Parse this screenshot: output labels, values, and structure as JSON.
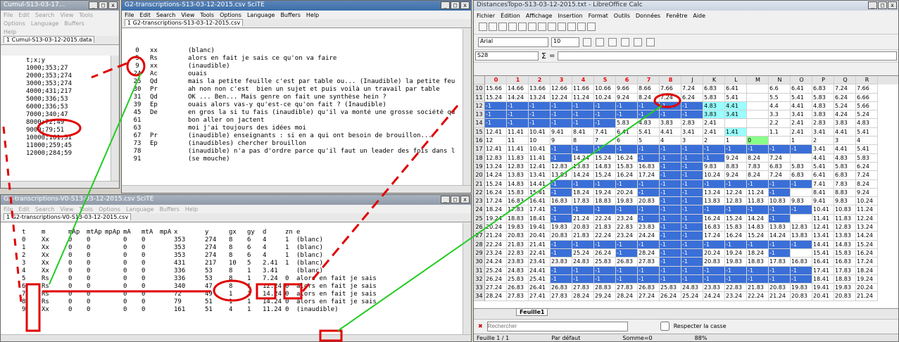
{
  "colors": {
    "annot_red": "#e00000",
    "annot_green": "#22cc22",
    "cell_blue": "#3a6fd8",
    "cell_cyan": "#99ffff",
    "cell_green": "#88ff88"
  },
  "w1": {
    "title": "Cumul-S13-03-17...",
    "menu": [
      "File",
      "Edit",
      "Search",
      "View",
      "Tools"
    ],
    "menu2": [
      "Options",
      "Language",
      "Buffers"
    ],
    "menu3": [
      "Help"
    ],
    "tab": "1 Cumul-S13-03-12-2015.data",
    "lines": [
      "t;x;y",
      "1000;353;27",
      "2000;353;274",
      "3000;353;274",
      "4000;431;217",
      "5000;336;53",
      "6000;336;53",
      "7000;340;47",
      "8000;72;49",
      "9000;79;51",
      "10000;161;51",
      "11000;259;45",
      "12000;284;59"
    ]
  },
  "w2": {
    "title": "G2-transcriptions-S13-03-12-2015.csv  SciTE",
    "menu": [
      "File",
      "Edit",
      "Search",
      "View",
      "Tools",
      "Options",
      "Language",
      "Buffers",
      "Help"
    ],
    "tab": "1 G2-transcriptions-S13-03-12-2015.csv",
    "rows": [
      {
        "n": "0",
        "s": "xx",
        "t": "(blanc)"
      },
      {
        "n": "5",
        "s": "Rs",
        "t": "alors en fait je sais ce qu'on va faire"
      },
      {
        "n": "9",
        "s": "xx",
        "t": "(inaudible)"
      },
      {
        "n": "24",
        "s": "Ac",
        "t": "ouais"
      },
      {
        "n": "25",
        "s": "Qd",
        "t": "mais la petite feuille c'est par table ou... (Inaudible) la petite feuille"
      },
      {
        "n": "30",
        "s": "Pr",
        "t": "ah non non c'est  bien un sujet et puis voilà un travail par table"
      },
      {
        "n": "31",
        "s": "Qd",
        "t": "OK ... Ben... Mais genre on fait une synthèse hein ?"
      },
      {
        "n": "39",
        "s": "Ep",
        "t": "ouais alors vas-y qu'est-ce qu'on fait ? (Inaudible)"
      },
      {
        "n": "45",
        "s": "De",
        "t": "en gros la si tu fais (inaudible) qu'il va monté une grosse société qu"
      },
      {
        "n": "61",
        "s": "",
        "t": "bon aller on jactent"
      },
      {
        "n": "63",
        "s": "",
        "t": "moi j'ai toujours des idées moi"
      },
      {
        "n": "67",
        "s": "Pr",
        "t": "(inaudible) enseignants : si en a qui ont besoin de brouillon..."
      },
      {
        "n": "73",
        "s": "Ep",
        "t": "(inaudibles) chercher brouillon"
      },
      {
        "n": "78",
        "s": "",
        "t": "(inaudible) n'a pas d'ordre parce qu'il faut un leader des fois dans la"
      },
      {
        "n": "91",
        "s": "",
        "t": "(se mouche)"
      }
    ]
  },
  "w3": {
    "title": "G2-transcriptions-V0-S13-03-12-2015.csv  SciTE",
    "menu": [
      "File",
      "Edit",
      "Search",
      "View",
      "Tools",
      "Options",
      "Language",
      "Buffers",
      "Help"
    ],
    "tab": "1 G2-transcriptions-V0-S13-03-12-2015.csv",
    "headers": [
      "t",
      "m",
      "mAp",
      "mtAp",
      "mpAp",
      "mA",
      "mtA",
      "mpA",
      "x",
      "y",
      "gx",
      "gy",
      "d",
      "zn",
      "e"
    ],
    "rows": [
      [
        "0",
        "Xx",
        "0",
        "0",
        "",
        "0",
        "0",
        "",
        "353",
        "274",
        "8",
        "6",
        "4",
        "1",
        "(blanc)"
      ],
      [
        "1",
        "Xx",
        "0",
        "0",
        "",
        "0",
        "0",
        "",
        "353",
        "274",
        "8",
        "6",
        "4",
        "1",
        "(blanc)"
      ],
      [
        "2",
        "Xx",
        "0",
        "0",
        "",
        "0",
        "0",
        "",
        "353",
        "274",
        "8",
        "6",
        "4",
        "1",
        "(blanc)"
      ],
      [
        "3",
        "Xx",
        "0",
        "0",
        "",
        "0",
        "0",
        "",
        "431",
        "217",
        "10",
        "5",
        "2.41",
        "1",
        "(blanc)"
      ],
      [
        "4",
        "Xx",
        "0",
        "0",
        "",
        "0",
        "0",
        "",
        "336",
        "53",
        "8",
        "1",
        "3.41",
        "",
        "(blanc)"
      ],
      [
        "5",
        "Rs",
        "0",
        "0",
        "",
        "0",
        "0",
        "",
        "336",
        "53",
        "8",
        "1",
        "7.24",
        "0",
        "alors en fait je sais ce qu"
      ],
      [
        "6",
        "Rs",
        "0",
        "0",
        "",
        "0",
        "0",
        "",
        "340",
        "47",
        "8",
        "1",
        "12.24",
        "0",
        "alors en fait je sais ce qu"
      ],
      [
        "7",
        "Rs",
        "0",
        "0",
        "",
        "0",
        "0",
        "",
        "72",
        "49",
        "1",
        "1",
        "14.24",
        "0",
        "alors en fait je sais ce qu"
      ],
      [
        "8",
        "Rs",
        "0",
        "0",
        "",
        "0",
        "0",
        "",
        "79",
        "51",
        "1",
        "1",
        "14.24",
        "0",
        "alors en fait je sais ce qu"
      ],
      [
        "9",
        "Xx",
        "0",
        "0",
        "",
        "0",
        "0",
        "",
        "161",
        "51",
        "4",
        "1",
        "11.24",
        "0",
        "(inaudible)"
      ]
    ]
  },
  "w4": {
    "title": "DistancesTopo-S13-03-12-2015.txt - LibreOffice Calc",
    "menu": [
      "Fichier",
      "Édition",
      "Affichage",
      "Insertion",
      "Format",
      "Outils",
      "Données",
      "Fenêtre",
      "Aide"
    ],
    "font": "Arial",
    "size": "10",
    "cellref": "S28",
    "sheet": "Feuille1",
    "search_placeholder": "Rechercher",
    "match_case": "Respecter la casse",
    "status": [
      "Feuille 1 / 1",
      "Par défaut",
      "Somme=0",
      "88%"
    ],
    "cols": [
      "A",
      "B",
      "C",
      "D",
      "E",
      "F",
      "G",
      "H",
      "I",
      "J",
      "K",
      "L",
      "M",
      "N",
      "O",
      "P",
      "Q",
      "R"
    ],
    "anno_cols": [
      "0",
      "1",
      "2",
      "3",
      "4",
      "5",
      "6",
      "7",
      "8"
    ],
    "rows": [
      [
        "15.66",
        "14.66",
        "13.66",
        "12.66",
        "11.66",
        "10.66",
        "9.66",
        "8.66",
        "7.66",
        "7.24",
        "6.83",
        "6.41",
        "",
        "6.6",
        "6.41",
        "6.83",
        "7.24",
        "7.66",
        "8.07"
      ],
      [
        "15.24",
        "14.24",
        "13.24",
        "12.24",
        "11.24",
        "10.24",
        "9.24",
        "8.24",
        "7.24",
        "6.24",
        "5.83",
        "5.41",
        "",
        "5.5",
        "5.41",
        "5.83",
        "6.24",
        "6.66",
        "7.07"
      ],
      [
        "-1",
        "-1",
        "-1",
        "-1",
        "-1",
        "-1",
        "-1",
        "-1",
        "-1",
        "-1",
        "4.83",
        "4.41",
        "",
        "4.4",
        "4.41",
        "4.83",
        "5.24",
        "5.66",
        "6.66"
      ],
      [
        "-1",
        "-1",
        "-1",
        "-1",
        "-1",
        "-1",
        "-1",
        "-1",
        "-1",
        "-1",
        "3.83",
        "3.41",
        "",
        "3.3",
        "3.41",
        "3.83",
        "4.24",
        "5.24",
        "6.24"
      ],
      [
        "-1",
        "-1",
        "-1",
        "-1",
        "-1",
        "-1",
        "5.83",
        "4.83",
        "3.83",
        "2.83",
        "2.41",
        "",
        "",
        "2.2",
        "2.41",
        "2.83",
        "3.83",
        "4.83",
        "5.83"
      ],
      [
        "12.41",
        "11.41",
        "10.41",
        "9.41",
        "8.41",
        "7.41",
        "6.41",
        "5.41",
        "4.41",
        "3.41",
        "2.41",
        "1.41",
        "",
        "1.1",
        "2.41",
        "3.41",
        "4.41",
        "5.41",
        ""
      ],
      [
        "12",
        "11",
        "10",
        "9",
        "8",
        "7",
        "6",
        "5",
        "4",
        "3",
        "2",
        "1",
        "0",
        "",
        "1",
        "2",
        "3",
        "4",
        "5"
      ],
      [
        "12.41",
        "11.41",
        "10.41",
        "-1",
        "-1",
        "-1",
        "-1",
        "-1",
        "-1",
        "-1",
        "-1",
        "-1",
        "-1",
        "-1",
        "-1",
        "3.41",
        "4.41",
        "5.41",
        ""
      ],
      [
        "12.83",
        "11.83",
        "11.41",
        "-1",
        "14.24",
        "15.24",
        "16.24",
        "-1",
        "-1",
        "-1",
        "-1",
        "9.24",
        "8.24",
        "7.24",
        "",
        "4.41",
        "4.83",
        "5.83",
        ""
      ],
      [
        "13.24",
        "12.83",
        "12.41",
        "12.83",
        "13.83",
        "14.83",
        "15.83",
        "16.83",
        "-1",
        "-1",
        "9.83",
        "8.83",
        "7.83",
        "6.83",
        "5.83",
        "5.41",
        "5.83",
        "6.24",
        ""
      ],
      [
        "14.24",
        "13.83",
        "13.41",
        "13.83",
        "14.24",
        "15.24",
        "16.24",
        "17.24",
        "-1",
        "-1",
        "10.24",
        "9.24",
        "8.24",
        "7.24",
        "6.83",
        "6.41",
        "6.83",
        "7.24",
        ""
      ],
      [
        "15.24",
        "14.83",
        "14.41",
        "-1",
        "-1",
        "-1",
        "-1",
        "-1",
        "-1",
        "-1",
        "-1",
        "-1",
        "-1",
        "-1",
        "-1",
        "7.41",
        "7.83",
        "8.24",
        ""
      ],
      [
        "16.24",
        "15.83",
        "15.41",
        "-1",
        "18.24",
        "19.24",
        "20.24",
        "-1",
        "-1",
        "-1",
        "13.24",
        "12.24",
        "11.24",
        "-1",
        "",
        "8.41",
        "8.83",
        "9.24",
        ""
      ],
      [
        "17.24",
        "16.83",
        "16.41",
        "16.83",
        "17.83",
        "18.83",
        "19.83",
        "20.83",
        "-1",
        "-1",
        "13.83",
        "12.83",
        "11.83",
        "10.83",
        "9.83",
        "9.41",
        "9.83",
        "10.24",
        ""
      ],
      [
        "18.24",
        "17.83",
        "17.41",
        "-1",
        "-1",
        "-1",
        "-1",
        "-1",
        "-1",
        "-1",
        "-1",
        "-1",
        "-1",
        "-1",
        "-1",
        "10.41",
        "10.83",
        "11.24",
        ""
      ],
      [
        "19.24",
        "18.83",
        "18.41",
        "-1",
        "21.24",
        "22.24",
        "23.24",
        "-1",
        "-1",
        "-1",
        "16.24",
        "15.24",
        "14.24",
        "-1",
        "",
        "11.41",
        "11.83",
        "12.24",
        ""
      ],
      [
        "20.24",
        "19.83",
        "19.41",
        "19.83",
        "20.83",
        "21.83",
        "22.83",
        "23.83",
        "-1",
        "-1",
        "16.83",
        "15.83",
        "14.83",
        "13.83",
        "12.83",
        "12.41",
        "12.83",
        "13.24",
        ""
      ],
      [
        "21.24",
        "20.83",
        "20.41",
        "20.83",
        "21.83",
        "22.24",
        "23.24",
        "24.24",
        "-1",
        "-1",
        "17.24",
        "16.24",
        "15.24",
        "14.24",
        "13.83",
        "13.41",
        "13.83",
        "14.24",
        ""
      ],
      [
        "22.24",
        "21.83",
        "21.41",
        "-1",
        "-1",
        "-1",
        "-1",
        "-1",
        "-1",
        "-1",
        "-1",
        "-1",
        "-1",
        "-1",
        "-1",
        "14.41",
        "14.83",
        "15.24",
        ""
      ],
      [
        "23.24",
        "22.83",
        "22.41",
        "-1",
        "25.24",
        "26.24",
        "-1",
        "28.24",
        "-1",
        "-1",
        "20.24",
        "19.24",
        "18.24",
        "-1",
        "",
        "15.41",
        "15.83",
        "16.24",
        ""
      ],
      [
        "24.24",
        "23.83",
        "23.41",
        "23.83",
        "24.83",
        "25.83",
        "26.83",
        "27.83",
        "-1",
        "-1",
        "20.83",
        "19.83",
        "18.83",
        "17.83",
        "16.83",
        "16.41",
        "16.83",
        "17.24",
        ""
      ],
      [
        "25.24",
        "24.83",
        "24.41",
        "-1",
        "-1",
        "-1",
        "-1",
        "-1",
        "-1",
        "-1",
        "-1",
        "-1",
        "-1",
        "-1",
        "-1",
        "17.41",
        "17.83",
        "18.24",
        ""
      ],
      [
        "26.24",
        "25.83",
        "25.41",
        "-1",
        "-1",
        "-1",
        "-1",
        "-1",
        "-1",
        "-1",
        "-1",
        "-1",
        "-1",
        "-1",
        "-1",
        "18.41",
        "18.83",
        "19.24",
        ""
      ],
      [
        "27.24",
        "26.83",
        "26.41",
        "26.83",
        "27.83",
        "28.83",
        "27.83",
        "26.83",
        "25.83",
        "24.83",
        "23.83",
        "22.83",
        "21.83",
        "20.83",
        "19.83",
        "19.41",
        "19.83",
        "20.24",
        ""
      ],
      [
        "28.24",
        "27.83",
        "27.41",
        "27.83",
        "28.24",
        "29.24",
        "28.24",
        "27.24",
        "26.24",
        "25.24",
        "24.24",
        "23.24",
        "22.24",
        "21.24",
        "20.83",
        "20.41",
        "20.83",
        "21.24",
        ""
      ]
    ]
  }
}
